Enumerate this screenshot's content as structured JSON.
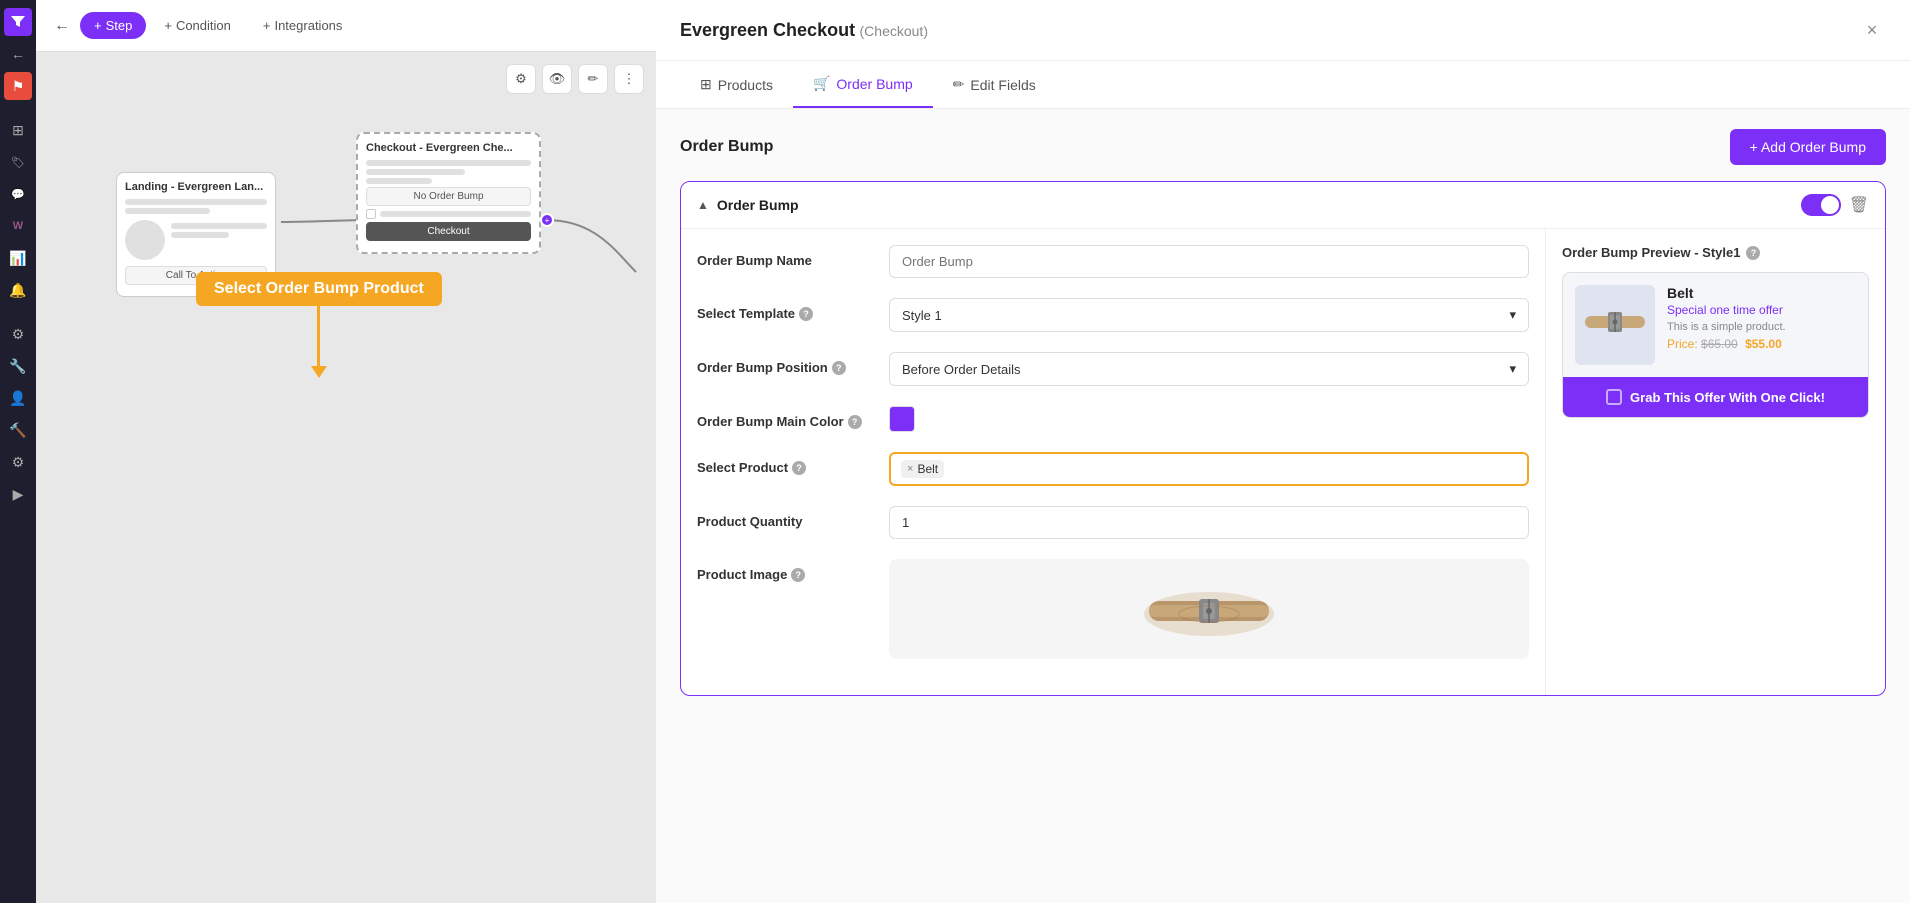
{
  "sidebar": {
    "icons": [
      {
        "name": "funnel-icon",
        "symbol": "▼",
        "active": true
      },
      {
        "name": "cursor-icon",
        "symbol": "↖"
      },
      {
        "name": "flag-icon",
        "symbol": "⚑",
        "highlight": true
      },
      {
        "name": "grid-icon",
        "symbol": "⊞"
      },
      {
        "name": "tag-icon",
        "symbol": "🏷"
      },
      {
        "name": "chat-icon",
        "symbol": "💬"
      },
      {
        "name": "woo-icon",
        "symbol": "W"
      },
      {
        "name": "chart-icon",
        "symbol": "📊"
      },
      {
        "name": "bell-icon",
        "symbol": "🔔"
      },
      {
        "name": "settings-icon",
        "symbol": "⚙"
      },
      {
        "name": "wrench-icon",
        "symbol": "🔧"
      },
      {
        "name": "user-icon",
        "symbol": "👤"
      },
      {
        "name": "tool-icon",
        "symbol": "🔨"
      },
      {
        "name": "sliders-icon",
        "symbol": "⚙"
      },
      {
        "name": "play-icon",
        "symbol": "▶"
      }
    ]
  },
  "topbar": {
    "back_label": "←",
    "tabs": [
      {
        "label": "Step",
        "prefix": "+",
        "active": true
      },
      {
        "label": "Condition",
        "prefix": "+"
      },
      {
        "label": "Integrations",
        "prefix": "+"
      }
    ]
  },
  "canvas_tools": [
    "⚙",
    "👁",
    "✏",
    "⋮"
  ],
  "flow": {
    "landing_node": {
      "header": "Landing - Evergreen Lan...",
      "cta": "Call To Action"
    },
    "checkout_node": {
      "header": "Checkout - Evergreen Che...",
      "no_order_bump": "No Order Bump",
      "checkout_label": "Checkout"
    }
  },
  "annotation": {
    "label": "Select Order Bump Product"
  },
  "panel": {
    "title": "Evergreen Checkout",
    "subtitle": "(Checkout)",
    "close": "×",
    "tabs": [
      {
        "label": "Products",
        "icon": "⊞"
      },
      {
        "label": "Order Bump",
        "icon": "🛒",
        "active": true
      },
      {
        "label": "Edit Fields",
        "icon": "✏"
      }
    ],
    "order_bump_section": {
      "title": "Order Bump",
      "add_button": "+ Add Order Bump"
    },
    "card": {
      "header": "Order Bump",
      "toggle_on": true,
      "form": {
        "name_label": "Order Bump Name",
        "name_placeholder": "Order Bump",
        "template_label": "Select Template",
        "template_value": "Style 1",
        "position_label": "Order Bump Position",
        "position_value": "Before Order Details",
        "color_label": "Order Bump Main Color",
        "color_value": "#7b2ff7",
        "product_label": "Select Product",
        "product_selected": "Belt",
        "quantity_label": "Product Quantity",
        "quantity_value": "1",
        "image_label": "Product Image"
      },
      "preview": {
        "title": "Order Bump Preview - Style1",
        "product_name": "Belt",
        "offer_text": "Special one time offer",
        "description": "This is a simple product.",
        "original_price": "$65.00",
        "sale_price": "$55.00",
        "price_label": "Price:",
        "grab_btn": "Grab This Offer With One Click!"
      }
    }
  }
}
